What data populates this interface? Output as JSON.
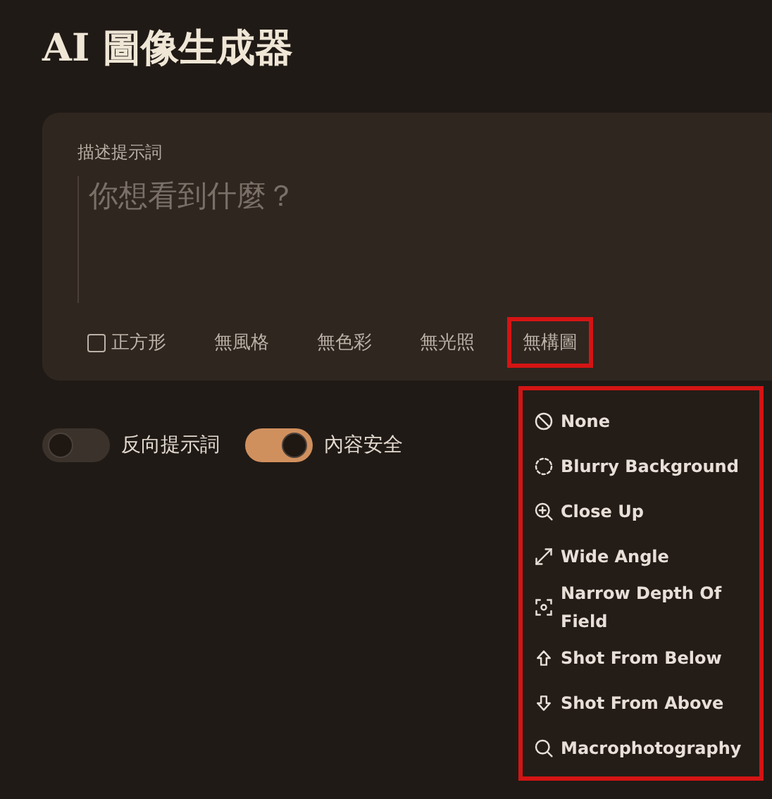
{
  "title": "AI 圖像生成器",
  "prompt": {
    "label": "描述提示詞",
    "placeholder": "你想看到什麼？"
  },
  "options": [
    {
      "kind": "checkbox",
      "label": "正方形",
      "checked": false,
      "highlighted": false
    },
    {
      "kind": "chip",
      "label": "無風格",
      "highlighted": false
    },
    {
      "kind": "chip",
      "label": "無色彩",
      "highlighted": false
    },
    {
      "kind": "chip",
      "label": "無光照",
      "highlighted": false
    },
    {
      "kind": "chip",
      "label": "無構圖",
      "highlighted": true
    }
  ],
  "toggles": [
    {
      "label": "反向提示詞",
      "on": false
    },
    {
      "label": "內容安全",
      "on": true
    }
  ],
  "menu": {
    "highlighted": true,
    "items": [
      {
        "label": "None"
      },
      {
        "label": "Blurry Background"
      },
      {
        "label": "Close Up"
      },
      {
        "label": "Wide Angle"
      },
      {
        "label": "Narrow Depth Of Field"
      },
      {
        "label": "Shot From Below"
      },
      {
        "label": "Shot From Above"
      },
      {
        "label": "Macrophotography"
      }
    ]
  }
}
